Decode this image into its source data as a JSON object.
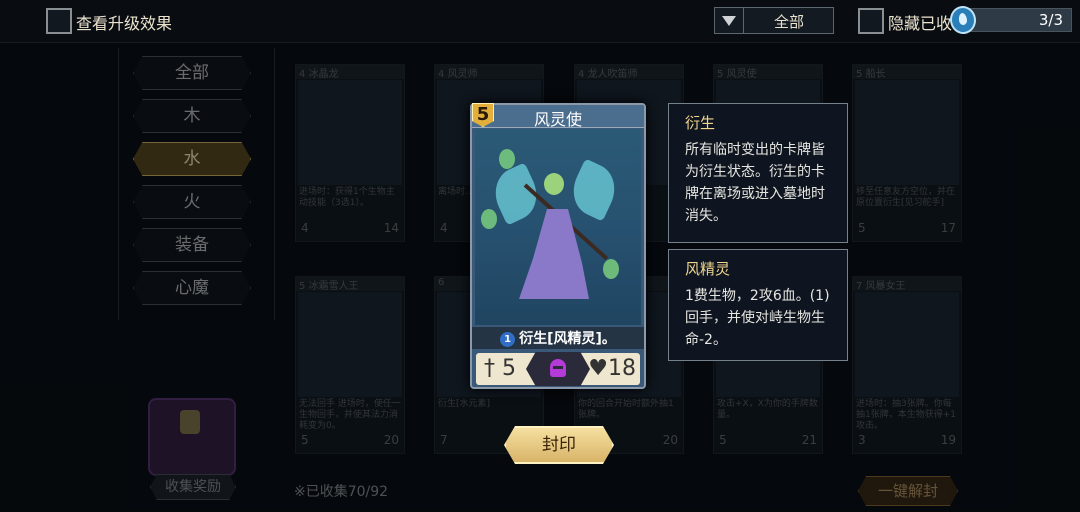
{
  "topbar": {
    "show_upgrade_label": "查看升级效果",
    "filter_selected": "全部",
    "hide_collected_label": "隐藏已收",
    "progress_text": "3/3",
    "progress_fraction": 1.0
  },
  "sidebar": {
    "items": [
      {
        "label": "全部"
      },
      {
        "label": "木"
      },
      {
        "label": "水",
        "active": true
      },
      {
        "label": "火"
      },
      {
        "label": "装备"
      },
      {
        "label": "心魔"
      }
    ]
  },
  "background_cards": [
    {
      "cost": "4",
      "name": "冰晶龙",
      "desc": "进场时：获得1个生物主动技能（3选1）。",
      "atk": "4",
      "hp": "14"
    },
    {
      "cost": "4",
      "name": "风灵师",
      "desc": "离场时...加入你...",
      "atk": "4",
      "hp": ""
    },
    {
      "cost": "4",
      "name": "龙人吹笛师",
      "desc": "...物进...X...用。",
      "atk": "",
      "hp": ""
    },
    {
      "cost": "5",
      "name": "风灵使",
      "desc": "",
      "atk": "",
      "hp": ""
    },
    {
      "cost": "5",
      "name": "船长",
      "desc": "移至任意友方空位，并在原位置衍生[见习舵手]",
      "atk": "5",
      "hp": "17"
    },
    {
      "cost": "5",
      "name": "冰霜雪人王",
      "desc": "无法回手 进场时，使任一生物回手，并使其法力消耗变为0。",
      "atk": "5",
      "hp": "20"
    },
    {
      "cost": "6",
      "name": "",
      "desc": "衍生[水元素]",
      "atk": "7",
      "hp": ""
    },
    {
      "cost": "",
      "name": "",
      "desc": "你的回合开始时额外抽1张牌。",
      "atk": "",
      "hp": "20"
    },
    {
      "cost": "",
      "name": "",
      "desc": "攻击+X，X为你的手牌数量。",
      "atk": "5",
      "hp": "21"
    },
    {
      "cost": "7",
      "name": "风暴女王",
      "desc": "进场时：抽3张牌。你每抽1张牌，本生物获得+1攻击。",
      "atk": "3",
      "hp": "19"
    }
  ],
  "bottom": {
    "collect_reward": "收集奖励",
    "collected_text": "※已收集70/92",
    "one_click_unlock": "一键解封"
  },
  "featured_card": {
    "cost": "5",
    "name": "风灵使",
    "level": "1",
    "ability": "衍生[风精灵]。",
    "atk": "5",
    "hp": "18"
  },
  "tooltips": [
    {
      "title": "衍生",
      "body": "所有临时变出的卡牌皆为衍生状态。衍生的卡牌在离场或进入墓地时消失。"
    },
    {
      "title": "风精灵",
      "body": "1费生物，2攻6血。(1)回手，并使对峙生物生命-2。"
    }
  ],
  "seal_button": "封印",
  "colors": {
    "accent_gold": "#e2b03a",
    "active_tab": "#5c4b22",
    "card_blue": "#3a5877"
  }
}
